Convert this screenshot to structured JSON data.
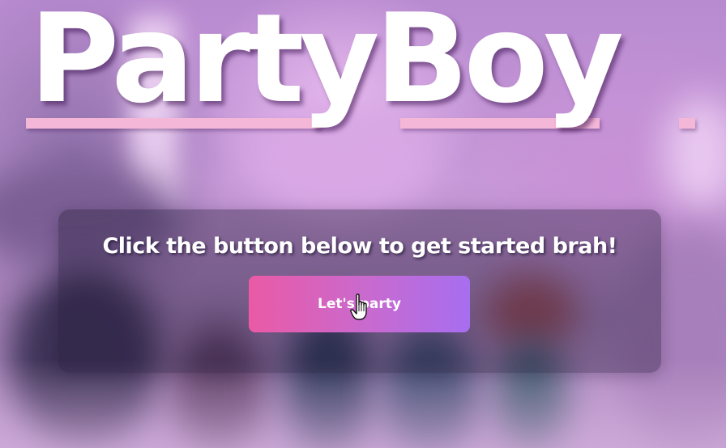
{
  "title": "PartyBoy",
  "card": {
    "message": "Click the button below to get started brah!",
    "button_label": "Let's party"
  },
  "colors": {
    "title": "#ffffff",
    "underline": "#f4b7d8",
    "button_gradient_start": "#ea5aa5",
    "button_gradient_end": "#a66ef0",
    "card_background": "rgba(40,30,60,0.38)"
  },
  "icons": {
    "cursor": "hand-pointer-cursor"
  }
}
